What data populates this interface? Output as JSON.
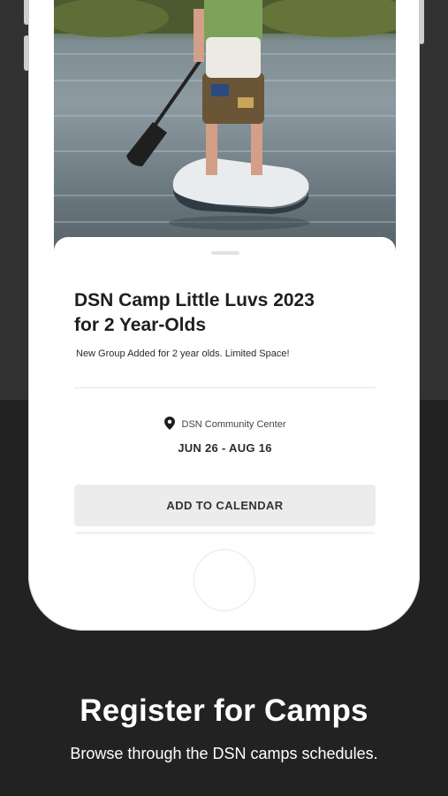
{
  "event": {
    "title_line1": "DSN Camp Little Luvs 2023",
    "title_line2": "for 2 Year-Olds",
    "subtitle": "New Group Added for 2 year olds. Limited Space!",
    "location": "DSN Community Center",
    "dates": "JUN 26 - AUG 16",
    "add_to_calendar_label": "ADD TO CALENDAR",
    "location_icon": "location-pin-icon"
  },
  "promo": {
    "title": "Register for Camps",
    "subtitle": "Browse through the DSN camps schedules."
  },
  "colors": {
    "background_top": "#333232",
    "background_bottom": "#232222",
    "phone_frame": "#ffffff",
    "button_bg": "#ececec",
    "text_dark": "#1e1e1e"
  }
}
